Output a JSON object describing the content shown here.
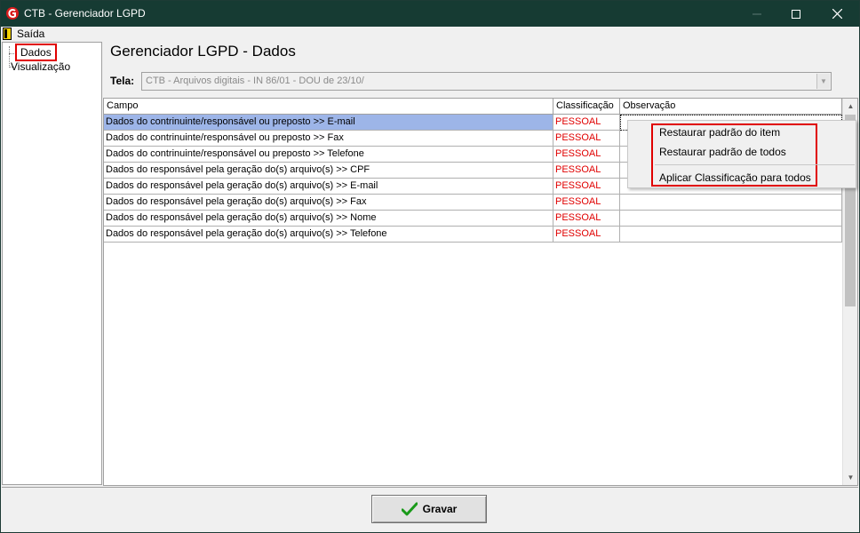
{
  "window": {
    "title": "CTB - Gerenciador LGPD",
    "icon": "app-logo-icon",
    "controls": [
      "minimize-icon",
      "maximize-icon",
      "close-icon"
    ]
  },
  "menubar": {
    "exit_label": "Saída",
    "exit_icon": "door-exit-icon"
  },
  "tree": {
    "items": [
      {
        "label": "Dados",
        "highlighted": true
      },
      {
        "label": "Visualização",
        "highlighted": false
      }
    ]
  },
  "main": {
    "page_title": "Gerenciador LGPD - Dados",
    "tela_label": "Tela:",
    "tela_value": "CTB - Arquivos digitais - IN 86/01 - DOU de 23/10/"
  },
  "grid": {
    "columns": [
      "Campo",
      "Classificação",
      "Observação"
    ],
    "rows": [
      {
        "campo": "Dados do contrinuinte/responsável ou preposto >> E-mail",
        "classificacao": "PESSOAL",
        "observacao": ""
      },
      {
        "campo": "Dados do contrinuinte/responsável ou preposto >> Fax",
        "classificacao": "PESSOAL",
        "observacao": ""
      },
      {
        "campo": "Dados do contrinuinte/responsável ou preposto >> Telefone",
        "classificacao": "PESSOAL",
        "observacao": ""
      },
      {
        "campo": "Dados do responsável pela geração do(s) arquivo(s) >> CPF",
        "classificacao": "PESSOAL",
        "observacao": ""
      },
      {
        "campo": "Dados do responsável pela geração do(s) arquivo(s) >> E-mail",
        "classificacao": "PESSOAL",
        "observacao": ""
      },
      {
        "campo": "Dados do responsável pela geração do(s) arquivo(s) >> Fax",
        "classificacao": "PESSOAL",
        "observacao": ""
      },
      {
        "campo": "Dados do responsável pela geração do(s) arquivo(s) >> Nome",
        "classificacao": "PESSOAL",
        "observacao": ""
      },
      {
        "campo": "Dados do responsável pela geração do(s) arquivo(s) >> Telefone",
        "classificacao": "PESSOAL",
        "observacao": ""
      }
    ],
    "selected_row": 0
  },
  "context_menu": {
    "items": [
      {
        "label": "Restaurar padrão do item",
        "accel": "R"
      },
      {
        "label": "Restaurar padrão de todos",
        "accel": "R"
      },
      {
        "label": "Aplicar Classificação para todos",
        "accel": "A"
      }
    ]
  },
  "footer": {
    "save_label": "Gravar",
    "save_icon": "green-check-icon"
  },
  "colors": {
    "titlebar": "#163b33",
    "selection": "#9db5e8",
    "classification_text": "#e00000",
    "highlight_border": "#e00000",
    "check_green": "#1a9a1a"
  }
}
